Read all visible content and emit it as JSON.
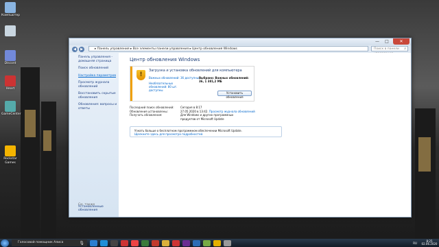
{
  "desktop": {
    "icons": [
      {
        "label": "Компьютер",
        "color": "#8ab4e0"
      },
      {
        "label": "",
        "color": "#c9d6e0"
      },
      {
        "label": "Discord",
        "color": "#7289da"
      },
      {
        "label": "Heart",
        "color": "#c33"
      },
      {
        "label": "GameCenter",
        "color": "#5aa"
      },
      {
        "label": "Rockstar Games",
        "color": "#f4b400"
      }
    ]
  },
  "window": {
    "controls": {
      "min": "—",
      "max": "□",
      "close": "✕"
    },
    "breadcrumb": "▸ Панель управления ▸ Все элементы панели управления ▸ Центр обновления Windows",
    "search_placeholder": "Поиск в панели управления",
    "sidebar": {
      "items": [
        "Панель управления - домашняя страница",
        "Поиск обновлений",
        "Настройка параметров",
        "Просмотр журнала обновлений",
        "Восстановить скрытые обновления",
        "Обновления: вопросы и ответы"
      ],
      "see_also": "См. также",
      "installed_updates": "Установленные обновления"
    },
    "content": {
      "title": "Центр обновления Windows",
      "update_box": {
        "title": "Загрузка и установка обновлений для компьютера",
        "important_link": "Важных обновлений: 36 доступны",
        "optional_link": "Необязательных обновлений: 80 шт. доступны",
        "selected": "Выбрано: Важных обновлений: 36, 1 381,2 МБ",
        "install_button": "Установить обновления"
      },
      "info": [
        {
          "key": "Последний поиск обновлений:",
          "value": "Сегодня в 8:17",
          "link": ""
        },
        {
          "key": "Обновления установлены:",
          "value": "27.05.2020 в 13:42.",
          "link": "Просмотр журнала обновлений"
        },
        {
          "key": "Получать обновления:",
          "value": "Для Windows и других программных продуктов от Microsoft Update",
          "link": ""
        }
      ],
      "notice": {
        "text": "Узнать больше о бесплатном программном обеспечении Microsoft Update.",
        "link": "Щелкните здесь для просмотра подробностей."
      }
    }
  },
  "taskbar": {
    "assistant": "Голосовой помощник Алиса",
    "lang": "RU",
    "time": "8:25",
    "date": "02.06.2020",
    "app_colors": [
      "#2b7fd0",
      "#1e8fd8",
      "#444",
      "#c33",
      "#e44",
      "#3a7a3a",
      "#c0392b",
      "#d9b03b",
      "#c33",
      "#6a2c91",
      "#2d6db5",
      "#7a4",
      "#e4b000",
      "#999"
    ]
  }
}
